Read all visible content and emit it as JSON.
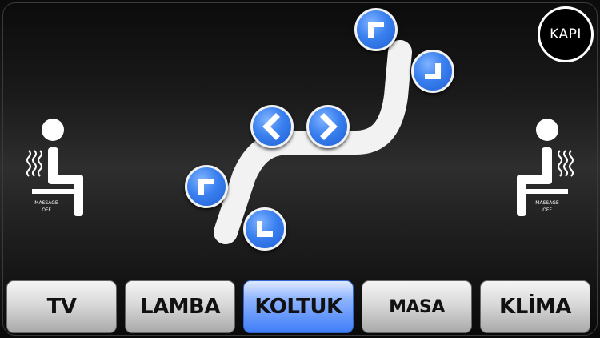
{
  "door": {
    "label": "KAPI"
  },
  "massage": {
    "left": {
      "line1": "MASSAGE",
      "line2": "OFF"
    },
    "right": {
      "line1": "MASSAGE",
      "line2": "OFF"
    }
  },
  "seat": {
    "controls": [
      {
        "name": "backrest-up",
        "icon": "corner-up-left-icon"
      },
      {
        "name": "backrest-down",
        "icon": "corner-down-right-icon"
      },
      {
        "name": "seat-backward",
        "icon": "chevron-left-icon"
      },
      {
        "name": "seat-forward",
        "icon": "chevron-right-icon"
      },
      {
        "name": "legrest-up",
        "icon": "corner-up-left-icon"
      },
      {
        "name": "legrest-down",
        "icon": "corner-down-left-icon"
      }
    ]
  },
  "tabs": [
    {
      "label": "TV",
      "active": false
    },
    {
      "label": "LAMBA",
      "active": false
    },
    {
      "label": "KOLTUK",
      "active": true
    },
    {
      "label": "MASA",
      "active": false
    },
    {
      "label": "KLİMA",
      "active": false
    }
  ],
  "colors": {
    "accent": "#3a80ef",
    "tab_active": "#3f7df7",
    "background": "#000000"
  }
}
